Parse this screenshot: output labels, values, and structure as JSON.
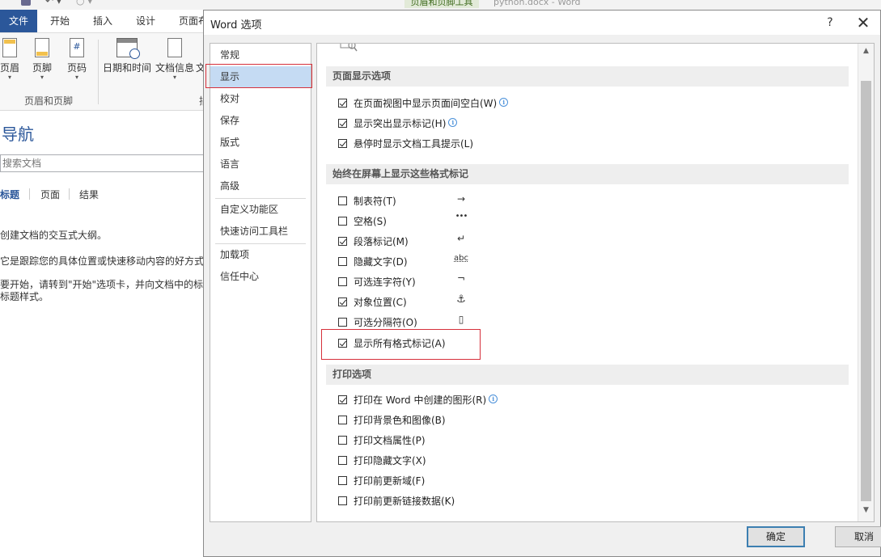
{
  "word": {
    "context_tab": "页眉和页脚工具",
    "doc_title": "python.docx - Word",
    "tabs": [
      "文件",
      "开始",
      "插入",
      "设计",
      "页面布"
    ],
    "ribbon_buttons": [
      "页眉",
      "页脚",
      "页码",
      "日期和时间",
      "文档信息",
      "文"
    ],
    "group_label": "页眉和页脚",
    "group_label2": "插",
    "nav": {
      "title": "导航",
      "search_placeholder": "搜索文档",
      "tabs": [
        "标题",
        "页面",
        "结果"
      ],
      "lines": [
        "创建文档的交互式大纲。",
        "它是跟踪您的具体位置或快速移动内容的好方式",
        "要开始，请转到\"开始\"选项卡，并向文档中的标",
        "标题样式。"
      ]
    }
  },
  "dialog": {
    "title": "Word 选项",
    "help": "?",
    "close": "✕",
    "categories": [
      "常规",
      "显示",
      "校对",
      "保存",
      "版式",
      "语言",
      "高级",
      "自定义功能区",
      "快速访问工具栏",
      "加载项",
      "信任中心"
    ],
    "selected_category": "显示",
    "sections": {
      "page_display": {
        "header": "页面显示选项",
        "options": [
          {
            "label": "在页面视图中显示页面间空白(W)",
            "checked": true,
            "info": true
          },
          {
            "label": "显示突出显示标记(H)",
            "checked": true,
            "info": true
          },
          {
            "label": "悬停时显示文档工具提示(L)",
            "checked": true,
            "info": false
          }
        ]
      },
      "format_marks": {
        "header": "始终在屏幕上显示这些格式标记",
        "options": [
          {
            "label": "制表符(T)",
            "checked": false,
            "symbol": "→"
          },
          {
            "label": "空格(S)",
            "checked": false,
            "symbol": "•••"
          },
          {
            "label": "段落标记(M)",
            "checked": true,
            "symbol": "↵"
          },
          {
            "label": "隐藏文字(D)",
            "checked": false,
            "symbol": "abc"
          },
          {
            "label": "可选连字符(Y)",
            "checked": false,
            "symbol": "¬"
          },
          {
            "label": "对象位置(C)",
            "checked": true,
            "symbol": "⚓"
          },
          {
            "label": "可选分隔符(O)",
            "checked": false,
            "symbol": "▯"
          },
          {
            "label": "显示所有格式标记(A)",
            "checked": true
          }
        ]
      },
      "print": {
        "header": "打印选项",
        "options": [
          {
            "label": "打印在 Word 中创建的图形(R)",
            "checked": true,
            "info": true
          },
          {
            "label": "打印背景色和图像(B)",
            "checked": false
          },
          {
            "label": "打印文档属性(P)",
            "checked": false
          },
          {
            "label": "打印隐藏文字(X)",
            "checked": false
          },
          {
            "label": "打印前更新域(F)",
            "checked": false
          },
          {
            "label": "打印前更新链接数据(K)",
            "checked": false
          }
        ]
      }
    },
    "ok": "确定",
    "cancel": "取消"
  },
  "colors": {
    "accent": "#2b579a",
    "highlight_border": "#d6303b",
    "selected_bg": "#c5dbf3"
  }
}
